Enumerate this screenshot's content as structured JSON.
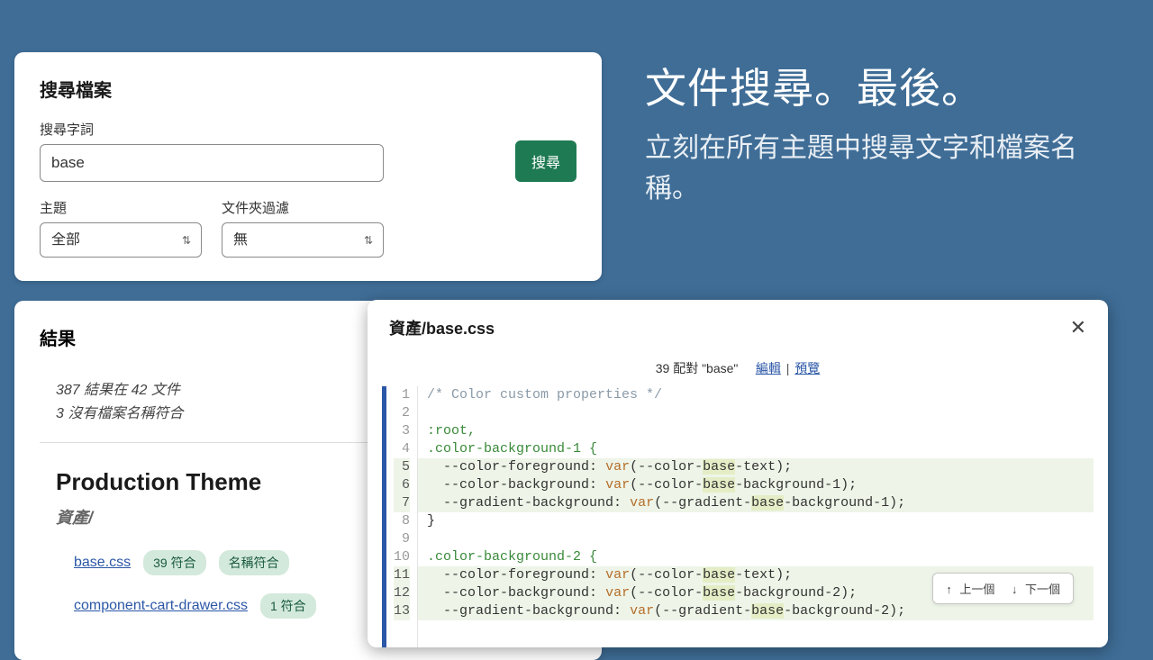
{
  "marketing": {
    "headline": "文件搜尋。最後。",
    "subline": "立刻在所有主題中搜尋文字和檔案名稱。"
  },
  "search_card": {
    "title": "搜尋檔案",
    "term_label": "搜尋字詞",
    "term_value": "base",
    "button": "搜尋",
    "theme_label": "主題",
    "theme_value": "全部",
    "folder_label": "文件夾過濾",
    "folder_value": "無"
  },
  "results": {
    "title": "結果",
    "summary1": "387 結果在 42 文件",
    "summary2": "3 沒有檔案名稱符合",
    "theme_name": "Production Theme",
    "folder": "資產/",
    "files": [
      {
        "name": "base.css",
        "match_count": "39 符合",
        "name_match": "名稱符合"
      },
      {
        "name": "component-cart-drawer.css",
        "match_count": "1 符合"
      }
    ]
  },
  "code_panel": {
    "filename": "資產/base.css",
    "match_info": "39 配對 \"base\"",
    "edit_link": "編輯",
    "preview_link": "預覽",
    "nav_prev": "↑ 上一個",
    "nav_next": "↓ 下一個",
    "lines": [
      {
        "n": 1,
        "hl": false,
        "text": "/* Color custom properties */",
        "type": "comment"
      },
      {
        "n": 2,
        "hl": false,
        "text": "",
        "type": "blank"
      },
      {
        "n": 3,
        "hl": false,
        "text": ":root,",
        "type": "sel"
      },
      {
        "n": 4,
        "hl": false,
        "text": ".color-background-1 {",
        "type": "sel"
      },
      {
        "n": 5,
        "hl": true,
        "text": "  --color-foreground: var(--color-|base|-text);",
        "type": "prop"
      },
      {
        "n": 6,
        "hl": true,
        "text": "  --color-background: var(--color-|base|-background-1);",
        "type": "prop"
      },
      {
        "n": 7,
        "hl": true,
        "text": "  --gradient-background: var(--gradient-|base|-background-1);",
        "type": "prop"
      },
      {
        "n": 8,
        "hl": false,
        "text": "}",
        "type": "plain"
      },
      {
        "n": 9,
        "hl": false,
        "text": "",
        "type": "blank"
      },
      {
        "n": 10,
        "hl": false,
        "text": ".color-background-2 {",
        "type": "sel"
      },
      {
        "n": 11,
        "hl": true,
        "text": "  --color-foreground: var(--color-|base|-text);",
        "type": "prop"
      },
      {
        "n": 12,
        "hl": true,
        "text": "  --color-background: var(--color-|base|-background-2);",
        "type": "prop"
      },
      {
        "n": 13,
        "hl": true,
        "text": "  --gradient-background: var(--gradient-|base|-background-2);",
        "type": "prop"
      }
    ]
  }
}
